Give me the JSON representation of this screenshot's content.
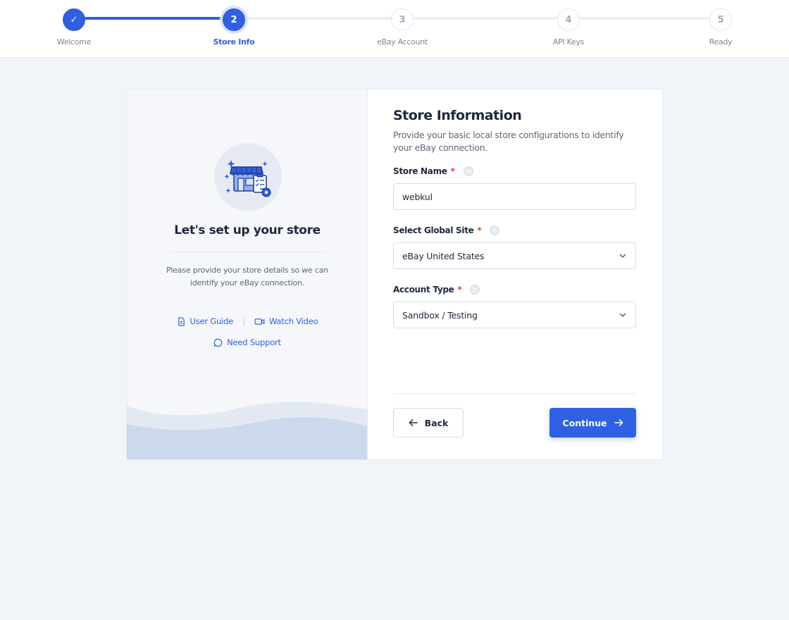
{
  "stepper": {
    "steps": [
      {
        "number": "✓",
        "label": "Welcome",
        "state": "completed"
      },
      {
        "number": "2",
        "label": "Store Info",
        "state": "active"
      },
      {
        "number": "3",
        "label": "eBay Account",
        "state": "pending"
      },
      {
        "number": "4",
        "label": "API Keys",
        "state": "pending"
      },
      {
        "number": "5",
        "label": "Ready",
        "state": "pending"
      }
    ]
  },
  "left": {
    "hero_icon": "store-icon",
    "title": "Let's set up your store",
    "description": "Please provide your store details so we can identify your eBay connection.",
    "links": {
      "user_guide": "User Guide",
      "separator": "|",
      "watch_video": "Watch Video",
      "need_support": "Need Support"
    }
  },
  "form": {
    "title": "Store Information",
    "description": "Provide your basic local store configurations to identify your eBay connection.",
    "store_name": {
      "label": "Store Name",
      "required": "*",
      "value": "webkul"
    },
    "global_site": {
      "label": "Select Global Site",
      "required": "*",
      "value": "eBay United States"
    },
    "account_type": {
      "label": "Account Type",
      "required": "*",
      "value": "Sandbox / Testing"
    }
  },
  "buttons": {
    "back": "Back",
    "continue": "Continue"
  },
  "colors": {
    "accent": "#2f5fe3",
    "required": "#e53935",
    "background": "#f1f4f8"
  }
}
